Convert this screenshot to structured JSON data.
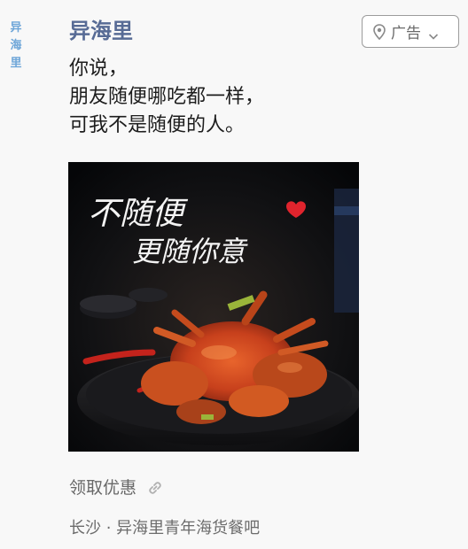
{
  "post": {
    "avatar_text": [
      "异",
      "海",
      "里"
    ],
    "username": "异海里",
    "ad_label": "广告",
    "message_lines": [
      "你说，",
      "朋友随便哪吃都一样，",
      "可我不是随便的人。"
    ],
    "image": {
      "caption_line1": "不随便",
      "caption_line2": "更随你意"
    },
    "coupon_label": "领取优惠",
    "location": "长沙 · 异海里青年海货餐吧"
  },
  "icons": {
    "ad_pin": "location-pin-icon",
    "ad_chevron": "chevron-down-icon",
    "coupon_link": "link-icon"
  },
  "colors": {
    "username": "#576b95",
    "avatar": "#6ea6d8",
    "heart": "#e0242d"
  }
}
